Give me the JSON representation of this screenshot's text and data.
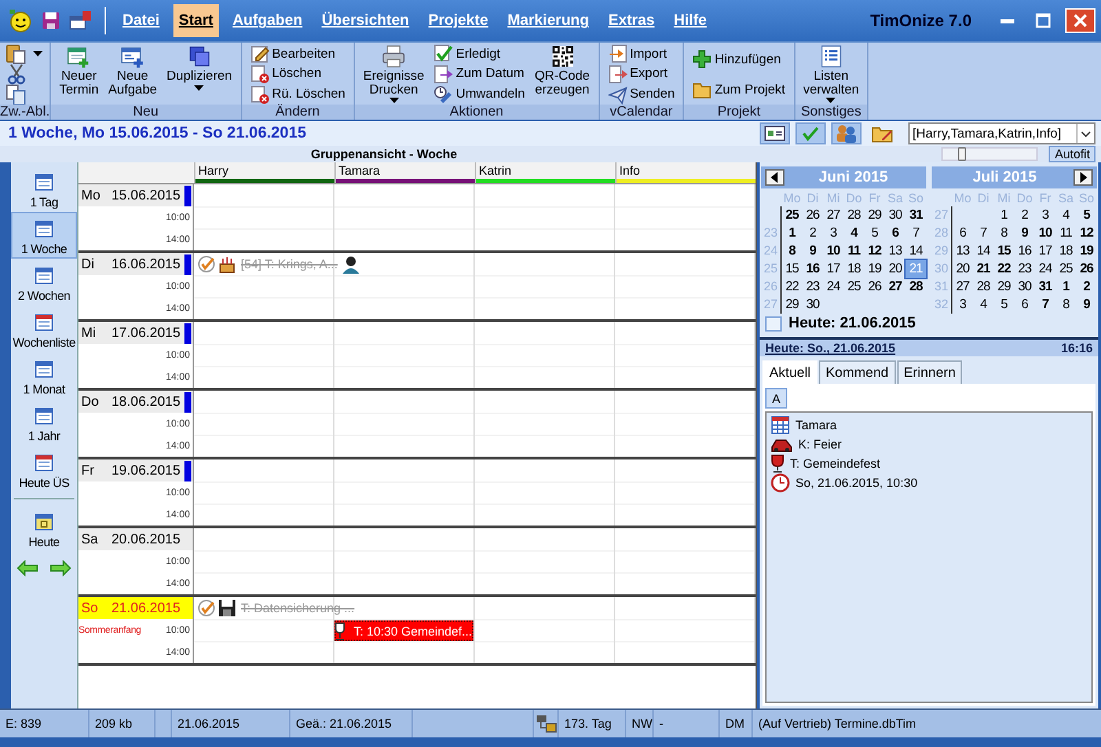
{
  "window": {
    "title": "TimOnize 7.0"
  },
  "menu": [
    {
      "label": "Datei",
      "selected": false
    },
    {
      "label": "Start",
      "selected": true
    },
    {
      "label": "Aufgaben",
      "selected": false
    },
    {
      "label": "Übersichten",
      "selected": false
    },
    {
      "label": "Projekte",
      "selected": false
    },
    {
      "label": "Markierung",
      "selected": false
    },
    {
      "label": "Extras",
      "selected": false
    },
    {
      "label": "Hilfe",
      "selected": false
    }
  ],
  "ribbon": [
    {
      "label": "Zw.-Abl.",
      "kind": "icons"
    },
    {
      "label": "Neu",
      "kind": "buttons",
      "buttons": [
        {
          "label": "Neuer\nTermin",
          "kind": "large",
          "dropdown": false
        },
        {
          "label": "Neue\nAufgabe",
          "kind": "large",
          "dropdown": false
        },
        {
          "label": "Duplizieren",
          "kind": "large",
          "dropdown": true
        }
      ]
    },
    {
      "label": "Ändern",
      "kind": "buttons",
      "buttons": [
        {
          "label": "Bearbeiten",
          "kind": "small"
        },
        {
          "label": "Löschen",
          "kind": "small"
        },
        {
          "label": "Rü. Löschen",
          "kind": "small"
        }
      ]
    },
    {
      "label": "Aktionen",
      "kind": "buttons",
      "buttons": [
        {
          "label": "Ereignisse\nDrucken",
          "kind": "large",
          "dropdown": true
        },
        {
          "label": "Erledigt",
          "kind": "small"
        },
        {
          "label": "Zum Datum",
          "kind": "small"
        },
        {
          "label": "Umwandeln",
          "kind": "small"
        },
        {
          "label": "QR-Code\nerzeugen",
          "kind": "large",
          "dropdown": false
        }
      ]
    },
    {
      "label": "vCalendar",
      "kind": "buttons",
      "buttons": [
        {
          "label": "Import",
          "kind": "small"
        },
        {
          "label": "Export",
          "kind": "small"
        },
        {
          "label": "Senden",
          "kind": "small"
        }
      ]
    },
    {
      "label": "Projekt",
      "kind": "buttons",
      "buttons": [
        {
          "label": "Hinzufügen",
          "kind": "small"
        },
        {
          "label": "Zum Projekt",
          "kind": "small"
        }
      ]
    },
    {
      "label": "Sonstiges",
      "kind": "buttons",
      "buttons": [
        {
          "label": "Listen\nverwalten",
          "kind": "large",
          "dropdown": true
        }
      ]
    }
  ],
  "header": {
    "title": "1 Woche, Mo 15.06.2015 - So 21.06.2015",
    "tools": [
      {
        "pressed": true
      },
      {
        "pressed": true
      },
      {
        "pressed": true
      },
      {
        "pressed": false
      }
    ],
    "filter": "[Harry,Tamara,Katrin,Info]"
  },
  "view_title": "Gruppenansicht - Woche",
  "zoom_slider": {
    "level": 0.2
  },
  "autofit": "Autofit",
  "nav": [
    {
      "label": "1 Tag",
      "selected": false
    },
    {
      "label": "1 Woche",
      "selected": true
    },
    {
      "label": "2 Wochen",
      "selected": false
    },
    {
      "label": "Wochenliste",
      "selected": false
    },
    {
      "label": "1 Monat",
      "selected": false
    },
    {
      "label": "1 Jahr",
      "selected": false
    },
    {
      "label": "Heute ÜS",
      "selected": false
    }
  ],
  "today_button": "Heute",
  "persons": [
    {
      "name": "Harry",
      "color": "#116611"
    },
    {
      "name": "Tamara",
      "color": "#771177"
    },
    {
      "name": "Katrin",
      "color": "#22dd22"
    },
    {
      "name": "Info",
      "color": "#eeee22"
    }
  ],
  "days": [
    {
      "day": "Mo",
      "date": "15.06.2015",
      "today": false,
      "marker": true,
      "times": [
        "10:00",
        "14:00"
      ]
    },
    {
      "day": "Di",
      "date": "16.06.2015",
      "today": false,
      "marker": true,
      "times": [
        "10:00",
        "14:00"
      ],
      "cells": [
        {
          "events": [
            {
              "kind": "birthday",
              "done": true,
              "text": "[54] T: Krings, A..."
            }
          ]
        },
        null,
        null,
        null
      ]
    },
    {
      "day": "Mi",
      "date": "17.06.2015",
      "today": false,
      "marker": true,
      "times": [
        "10:00",
        "14:00"
      ]
    },
    {
      "day": "Do",
      "date": "18.06.2015",
      "today": false,
      "marker": true,
      "times": [
        "10:00",
        "14:00"
      ]
    },
    {
      "day": "Fr",
      "date": "19.06.2015",
      "today": false,
      "marker": true,
      "times": [
        "10:00",
        "14:00"
      ]
    },
    {
      "day": "Sa",
      "date": "20.06.2015",
      "today": false,
      "marker": false,
      "times": [
        "10:00",
        "14:00"
      ]
    },
    {
      "day": "So",
      "date": "21.06.2015",
      "today": true,
      "marker": false,
      "holiday": "Sommeranfang",
      "times": [
        "10:00",
        "14:00"
      ],
      "cells": [
        {
          "events": [
            {
              "kind": "backup",
              "done": true,
              "text": "T: Datensicherung ..."
            }
          ]
        },
        {
          "events": [
            {
              "kind": "appointment",
              "done": false,
              "text": "T: 10:30 Gemeindef...",
              "color": "#ff0000"
            }
          ]
        },
        null,
        null
      ]
    }
  ],
  "calendar": {
    "months": [
      {
        "title": "Juni 2015",
        "kind": "prev",
        "weekdays": [
          "Mo",
          "Di",
          "Mi",
          "Do",
          "Fr",
          "Sa",
          "So"
        ],
        "weeks": [
          {
            "days": [
              {
                "day": "25",
                "bold": true,
                "selected": false
              },
              {
                "day": "26",
                "bold": false,
                "selected": false
              },
              {
                "day": "27",
                "bold": false,
                "selected": false
              },
              {
                "day": "28",
                "bold": false,
                "selected": false
              },
              {
                "day": "29",
                "bold": false,
                "selected": false
              },
              {
                "day": "30",
                "bold": false,
                "selected": false
              },
              {
                "day": "31",
                "bold": true,
                "selected": false
              }
            ]
          },
          {
            "week": "23",
            "days": [
              {
                "day": "1",
                "bold": true,
                "selected": false
              },
              {
                "day": "2",
                "bold": false,
                "selected": false
              },
              {
                "day": "3",
                "bold": false,
                "selected": false
              },
              {
                "day": "4",
                "bold": true,
                "selected": false
              },
              {
                "day": "5",
                "bold": false,
                "selected": false
              },
              {
                "day": "6",
                "bold": true,
                "selected": false
              },
              {
                "day": "7",
                "bold": false,
                "selected": false
              }
            ]
          },
          {
            "week": "24",
            "days": [
              {
                "day": "8",
                "bold": true,
                "selected": false
              },
              {
                "day": "9",
                "bold": true,
                "selected": false
              },
              {
                "day": "10",
                "bold": true,
                "selected": false
              },
              {
                "day": "11",
                "bold": true,
                "selected": false
              },
              {
                "day": "12",
                "bold": true,
                "selected": false
              },
              {
                "day": "13",
                "bold": false,
                "selected": false
              },
              {
                "day": "14",
                "bold": false,
                "selected": false
              }
            ]
          },
          {
            "week": "25",
            "days": [
              {
                "day": "15",
                "bold": false,
                "selected": false
              },
              {
                "day": "16",
                "bold": true,
                "selected": false
              },
              {
                "day": "17",
                "bold": false,
                "selected": false
              },
              {
                "day": "18",
                "bold": false,
                "selected": false
              },
              {
                "day": "19",
                "bold": false,
                "selected": false
              },
              {
                "day": "20",
                "bold": false,
                "selected": false
              },
              {
                "day": "21",
                "bold": false,
                "selected": true
              }
            ]
          },
          {
            "week": "26",
            "days": [
              {
                "day": "22",
                "bold": false,
                "selected": false
              },
              {
                "day": "23",
                "bold": false,
                "selected": false
              },
              {
                "day": "24",
                "bold": false,
                "selected": false
              },
              {
                "day": "25",
                "bold": false,
                "selected": false
              },
              {
                "day": "26",
                "bold": false,
                "selected": false
              },
              {
                "day": "27",
                "bold": true,
                "selected": false
              },
              {
                "day": "28",
                "bold": true,
                "selected": false
              }
            ]
          },
          {
            "week": "27",
            "days": [
              {
                "day": "29",
                "bold": false,
                "selected": false
              },
              {
                "day": "30",
                "bold": false,
                "selected": false
              }
            ]
          }
        ]
      },
      {
        "title": "Juli 2015",
        "kind": "next",
        "weekdays": [
          "Mo",
          "Di",
          "Mi",
          "Do",
          "Fr",
          "Sa",
          "So"
        ],
        "weeks": [
          {
            "week": "27",
            "days": [
              {
                "day": "1",
                "bold": false,
                "selected": false
              },
              {
                "day": "2",
                "bold": false,
                "selected": false
              },
              {
                "day": "3",
                "bold": false,
                "selected": false
              },
              {
                "day": "4",
                "bold": false,
                "selected": false
              },
              {
                "day": "5",
                "bold": true,
                "selected": false
              }
            ]
          },
          {
            "week": "28",
            "days": [
              {
                "day": "6",
                "bold": false,
                "selected": false
              },
              {
                "day": "7",
                "bold": false,
                "selected": false
              },
              {
                "day": "8",
                "bold": false,
                "selected": false
              },
              {
                "day": "9",
                "bold": true,
                "selected": false
              },
              {
                "day": "10",
                "bold": true,
                "selected": false
              },
              {
                "day": "11",
                "bold": false,
                "selected": false
              },
              {
                "day": "12",
                "bold": true,
                "selected": false
              }
            ]
          },
          {
            "week": "29",
            "days": [
              {
                "day": "13",
                "bold": false,
                "selected": false
              },
              {
                "day": "14",
                "bold": false,
                "selected": false
              },
              {
                "day": "15",
                "bold": true,
                "selected": false
              },
              {
                "day": "16",
                "bold": false,
                "selected": false
              },
              {
                "day": "17",
                "bold": false,
                "selected": false
              },
              {
                "day": "18",
                "bold": false,
                "selected": false
              },
              {
                "day": "19",
                "bold": true,
                "selected": false
              }
            ]
          },
          {
            "week": "30",
            "days": [
              {
                "day": "20",
                "bold": false,
                "selected": false
              },
              {
                "day": "21",
                "bold": true,
                "selected": false
              },
              {
                "day": "22",
                "bold": true,
                "selected": false
              },
              {
                "day": "23",
                "bold": false,
                "selected": false
              },
              {
                "day": "24",
                "bold": false,
                "selected": false
              },
              {
                "day": "25",
                "bold": false,
                "selected": false
              },
              {
                "day": "26",
                "bold": true,
                "selected": false
              }
            ]
          },
          {
            "week": "31",
            "days": [
              {
                "day": "27",
                "bold": false,
                "selected": false
              },
              {
                "day": "28",
                "bold": false,
                "selected": false
              },
              {
                "day": "29",
                "bold": false,
                "selected": false
              },
              {
                "day": "30",
                "bold": false,
                "selected": false
              },
              {
                "day": "31",
                "bold": true,
                "selected": false
              },
              {
                "day": "1",
                "bold": true,
                "selected": false
              },
              {
                "day": "2",
                "bold": true,
                "selected": false
              }
            ]
          },
          {
            "week": "32",
            "days": [
              {
                "day": "3",
                "bold": false,
                "selected": false
              },
              {
                "day": "4",
                "bold": false,
                "selected": false
              },
              {
                "day": "5",
                "bold": false,
                "selected": false
              },
              {
                "day": "6",
                "bold": false,
                "selected": false
              },
              {
                "day": "7",
                "bold": true,
                "selected": false
              },
              {
                "day": "8",
                "bold": false,
                "selected": false
              },
              {
                "day": "9",
                "bold": true,
                "selected": false
              }
            ]
          }
        ]
      }
    ],
    "today": "Heute: 21.06.2015"
  },
  "info": {
    "date_link": "Heute: So., 21.06.2015",
    "time": "16:16",
    "tabs": [
      {
        "label": "Aktuell",
        "selected": true
      },
      {
        "label": "Kommend",
        "selected": false
      },
      {
        "label": "Erinnern",
        "selected": false
      }
    ],
    "letters": [
      {
        "label": "A",
        "selected": true
      }
    ],
    "items": [
      {
        "kind": "person",
        "text": "Tamara"
      },
      {
        "kind": "category",
        "text": "K: Feier"
      },
      {
        "kind": "title",
        "text": "T: Gemeindefest"
      },
      {
        "kind": "time",
        "text": "So, 21.06.2015, 10:30"
      }
    ]
  },
  "status_bar": [
    {
      "kind": "text",
      "text": "E: 839"
    },
    {
      "kind": "text",
      "text": "209 kb"
    },
    {
      "kind": "blank"
    },
    {
      "kind": "text",
      "text": "21.06.2015"
    },
    {
      "kind": "text",
      "text": "Geä.: 21.06.2015"
    },
    {
      "kind": "blank"
    },
    {
      "kind": "icon"
    },
    {
      "kind": "text",
      "text": "173. Tag"
    },
    {
      "kind": "text",
      "text": "NW"
    },
    {
      "kind": "text",
      "text": "-"
    },
    {
      "kind": "text",
      "text": "DM"
    },
    {
      "kind": "text",
      "text": "(Auf Vertrieb) Termine.dbTim"
    }
  ]
}
